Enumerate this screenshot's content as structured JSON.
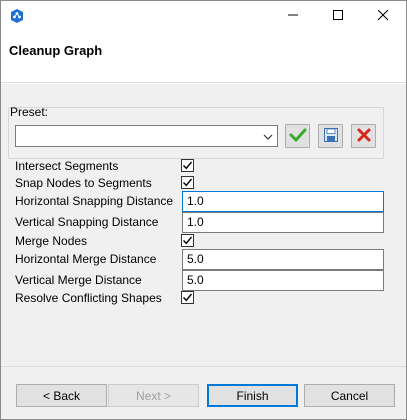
{
  "window": {
    "dialog_title": "Cleanup Graph",
    "icons": {
      "app": "app-icon",
      "minimize": "minimize-icon",
      "maximize": "maximize-icon",
      "close": "close-icon"
    }
  },
  "preset": {
    "label": "Preset:",
    "selected_value": "",
    "buttons": {
      "apply": "checkmark-icon",
      "save": "save-icon",
      "delete": "delete-icon"
    }
  },
  "options": {
    "intersect_segments": {
      "label": "Intersect Segments",
      "checked": true
    },
    "snap_nodes_to_segments": {
      "label": "Snap Nodes to Segments",
      "checked": true
    },
    "horizontal_snapping_distance": {
      "label": "Horizontal Snapping Distance",
      "value": "1.0"
    },
    "vertical_snapping_distance": {
      "label": "Vertical Snapping Distance",
      "value": "1.0"
    },
    "merge_nodes": {
      "label": "Merge Nodes",
      "checked": true
    },
    "horizontal_merge_distance": {
      "label": "Horizontal Merge Distance",
      "value": "5.0"
    },
    "vertical_merge_distance": {
      "label": "Vertical Merge Distance",
      "value": "5.0"
    },
    "resolve_conflicting_shapes": {
      "label": "Resolve Conflicting Shapes",
      "checked": true
    }
  },
  "footer": {
    "back_label": "< Back",
    "next_label": "Next >",
    "finish_label": "Finish",
    "cancel_label": "Cancel"
  },
  "colors": {
    "accent": "#0078d7",
    "apply_green": "#3aa82a",
    "delete_red": "#d9261c",
    "save_blue": "#3b6fb6"
  }
}
